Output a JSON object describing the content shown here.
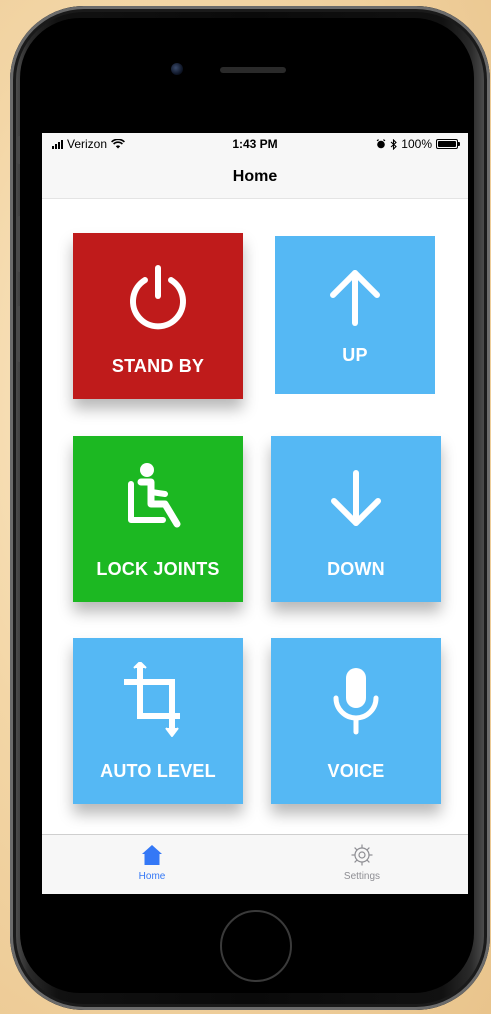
{
  "status_bar": {
    "carrier": "Verizon",
    "time": "1:43 PM",
    "battery": "100%"
  },
  "nav": {
    "title": "Home"
  },
  "tiles": [
    {
      "label": "STAND BY",
      "icon": "power-icon",
      "color": "#bf1b1b"
    },
    {
      "label": "UP",
      "icon": "arrow-up-icon",
      "color": "#55b8f4"
    },
    {
      "label": "LOCK JOINTS",
      "icon": "seated-person-icon",
      "color": "#1cb822"
    },
    {
      "label": "DOWN",
      "icon": "arrow-down-icon",
      "color": "#55b8f4"
    },
    {
      "label": "AUTO LEVEL",
      "icon": "crop-icon",
      "color": "#55b8f4"
    },
    {
      "label": "VOICE",
      "icon": "microphone-icon",
      "color": "#55b8f4"
    }
  ],
  "tab_bar": {
    "items": [
      {
        "label": "Home",
        "icon": "home-icon",
        "active": true,
        "color": "#3478f6"
      },
      {
        "label": "Settings",
        "icon": "gear-icon",
        "active": false,
        "color": "#8e8e93"
      }
    ]
  }
}
